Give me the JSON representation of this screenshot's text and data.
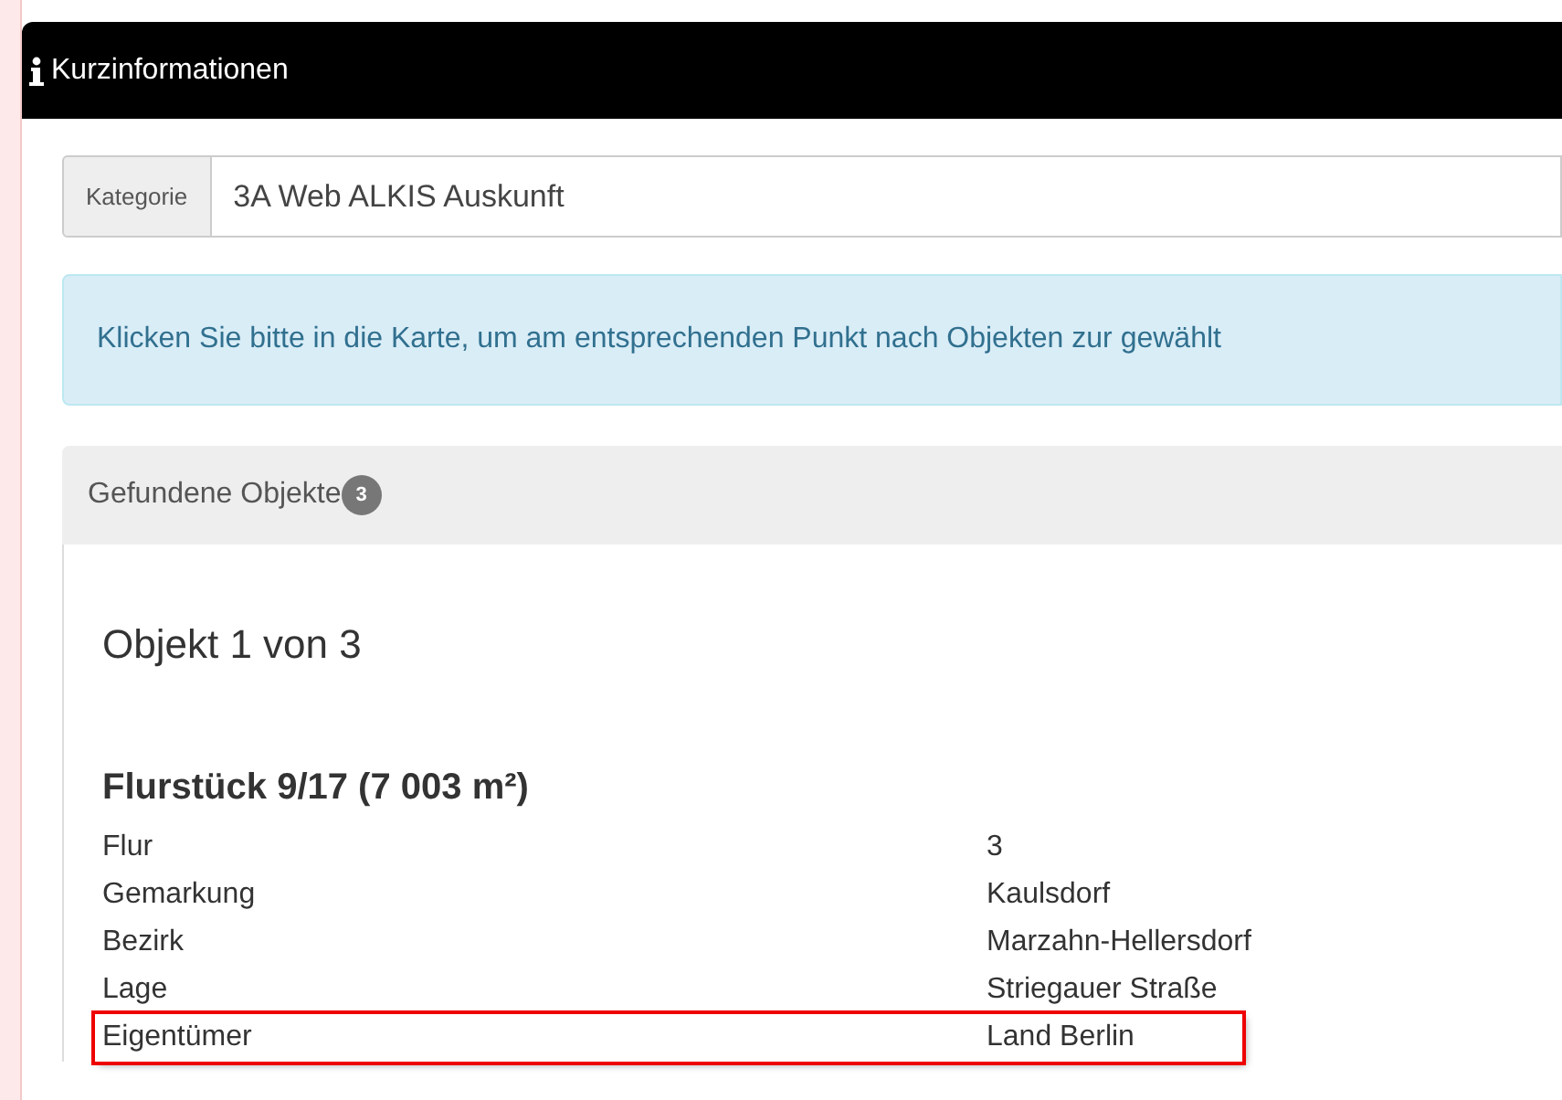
{
  "window": {
    "title": "Kurzinformationen"
  },
  "category": {
    "label": "Kategorie",
    "value": "3A Web ALKIS Auskunft"
  },
  "alert": {
    "text": "Klicken Sie bitte in die Karte, um am entsprechenden Punkt nach Objekten zur gewählt"
  },
  "panel": {
    "title": "Gefundene Objekte",
    "count": "3"
  },
  "object": {
    "counter": "Objekt 1 von 3",
    "heading": "Flurstück 9/17 (7 003 m²)",
    "rows": [
      {
        "label": "Flur",
        "value": "3",
        "highlighted": false
      },
      {
        "label": "Gemarkung",
        "value": "Kaulsdorf",
        "highlighted": false
      },
      {
        "label": "Bezirk",
        "value": "Marzahn-Hellersdorf",
        "highlighted": false
      },
      {
        "label": "Lage",
        "value": "Striegauer Straße",
        "highlighted": false
      },
      {
        "label": "Eigentümer",
        "value": "Land Berlin",
        "highlighted": true
      }
    ]
  }
}
